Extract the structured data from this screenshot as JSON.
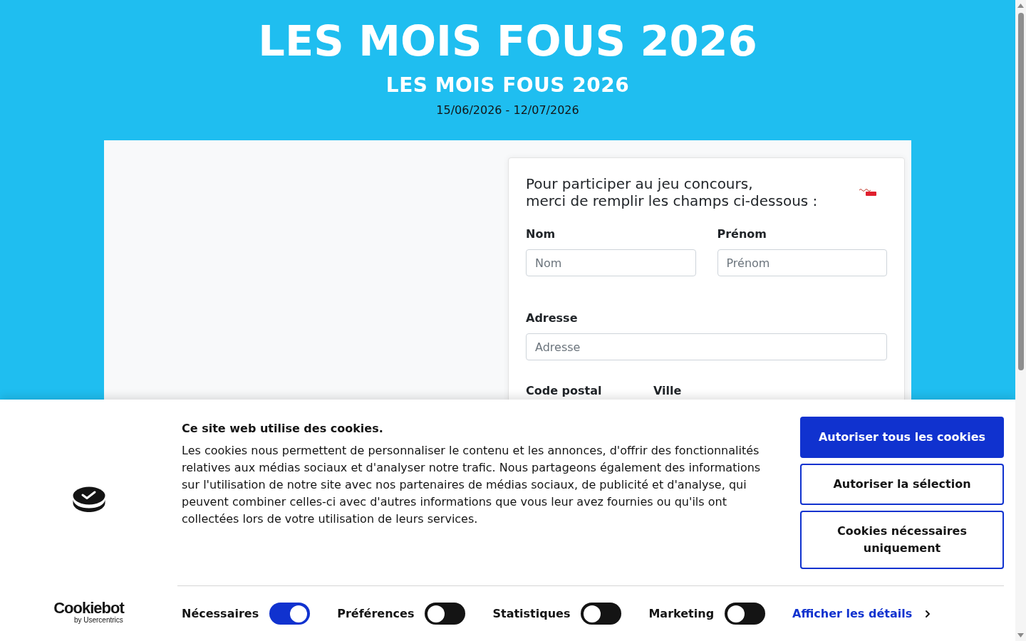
{
  "header": {
    "title": "LES MOIS FOUS 2026",
    "subtitle": "LES MOIS FOUS 2026",
    "dates": "15/06/2026 - 12/07/2026"
  },
  "form": {
    "intro": [
      "Pour participer au jeu concours,",
      "merci de remplir les champs ci-dessous :"
    ],
    "rows": [
      [
        {
          "label": "Nom",
          "placeholder": "Nom"
        },
        {
          "label": "Prénom",
          "placeholder": "Prénom"
        }
      ],
      [
        {
          "label": "Adresse",
          "placeholder": "Adresse"
        }
      ],
      [
        {
          "label": "Code postal"
        },
        {
          "label": "Ville"
        }
      ]
    ]
  },
  "cookie_banner": {
    "brand": {
      "name": "Cookiebot",
      "byline": "by Usercentrics"
    },
    "title": "Ce site web utilise des cookies.",
    "text": "Les cookies nous permettent de personnaliser le contenu et les annonces, d'offrir des fonctionnalités relatives aux médias sociaux et d'analyser notre trafic. Nous partageons également des informations sur l'utilisation de notre site avec nos partenaires de médias sociaux, de publicité et d'analyse, qui peuvent combiner celles-ci avec d'autres informations que vous leur avez fournies ou qu'ils ont collectées lors de votre utilisation de leurs services.",
    "buttons": [
      {
        "label": "Autoriser tous les cookies",
        "kind": "primary"
      },
      {
        "label": "Autoriser la sélection",
        "kind": "outline"
      },
      {
        "label": "Cookies nécessaires uniquement",
        "kind": "outline"
      }
    ],
    "toggles": [
      {
        "label": "Nécessaires",
        "on": true
      },
      {
        "label": "Préférences",
        "on": false
      },
      {
        "label": "Statistiques",
        "on": false
      },
      {
        "label": "Marketing",
        "on": false
      }
    ],
    "details_link": "Afficher les détails"
  }
}
